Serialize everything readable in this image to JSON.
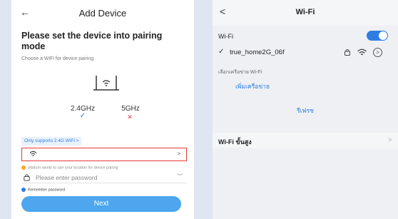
{
  "left": {
    "header": {
      "back_glyph": "←",
      "title": "Add Device"
    },
    "heading": "Please set the device into pairing mode",
    "subheading": "Choose a WiFi for device pairing",
    "bands": [
      {
        "label": "2.4GHz",
        "mark": "✓",
        "supported": true
      },
      {
        "label": "5GHz",
        "mark": "✕",
        "supported": false
      }
    ],
    "only_supports": "Only supports 2.4G WiFi >",
    "wifi_select": {
      "value": "",
      "chevron": ">"
    },
    "location_notice": "ottolum wants to use your location for device pairing",
    "password": {
      "placeholder": "Please enter password",
      "value": ""
    },
    "remember": "Remember password",
    "next_label": "Next",
    "accent": "#4da6ee",
    "highlight_border": "#e53935"
  },
  "right": {
    "header": {
      "back_glyph": "<",
      "title": "Wi-Fi"
    },
    "wifi_toggle": {
      "label": "Wi-Fi",
      "on": true
    },
    "current_network": {
      "name": "true_home2G_06f",
      "secured": true,
      "info_glyph": ">"
    },
    "select_network_label": "เลือกเครือข่าย Wi-Fi",
    "add_network_label": "เพิ่มเครือข่าย",
    "refresh_label": "รีเฟรช",
    "advanced_label": "Wi-Fi ขั้นสูง",
    "advanced_chevron": ">",
    "accent": "#2f7de1"
  }
}
